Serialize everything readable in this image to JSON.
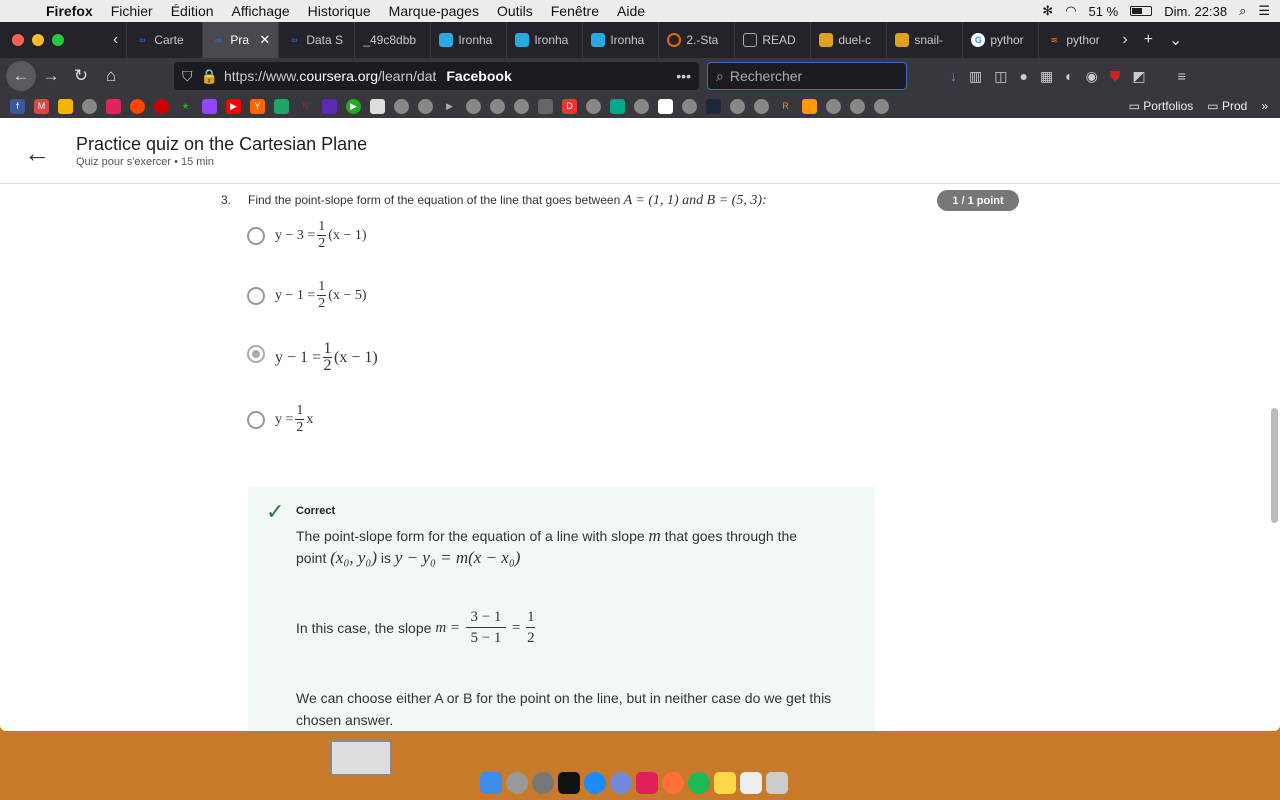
{
  "menubar": {
    "app": "Firefox",
    "items": [
      "Fichier",
      "Édition",
      "Affichage",
      "Historique",
      "Marque-pages",
      "Outils",
      "Fenêtre",
      "Aide"
    ],
    "battery": "51 %",
    "clock": "Dim. 22:38"
  },
  "tabs": [
    {
      "label": "Carte",
      "color": "#3d6fe0"
    },
    {
      "label": "Pra",
      "color": "#3d6fe0",
      "active": true
    },
    {
      "label": "Data S",
      "color": "#3d6fe0"
    },
    {
      "label": "_49c8dbb",
      "color": "#555"
    },
    {
      "label": "Ironha",
      "color": "#2aa9e0"
    },
    {
      "label": "Ironha",
      "color": "#2aa9e0"
    },
    {
      "label": "Ironha",
      "color": "#2aa9e0"
    },
    {
      "label": "2.-Sta",
      "color": "#e06a10"
    },
    {
      "label": "READ",
      "color": "#777"
    },
    {
      "label": "duel-c",
      "color": "#e0a020"
    },
    {
      "label": "snail-",
      "color": "#e0a020"
    },
    {
      "label": "pythor",
      "color": "#ffffff"
    },
    {
      "label": "pythor",
      "color": "#f48024"
    }
  ],
  "nav": {
    "url_prefix": "https://www.",
    "url_host": "coursera.org",
    "url_path": "/learn/dat",
    "page_label": "Facebook",
    "search_placeholder": "Rechercher"
  },
  "bookmarks": {
    "folders": [
      "Portfolios",
      "Prod"
    ]
  },
  "quiz": {
    "title": "Practice quiz on the Cartesian Plane",
    "subtitle": "Quiz pour s'exercer • 15 min",
    "question_number": "3.",
    "question_text": "Find the point-slope form of the equation of the line that goes between",
    "question_math": "A = (1, 1) and B = (5, 3):",
    "score": "1 / 1 point",
    "options": [
      {
        "lhs": "y − 3 =",
        "num": "1",
        "den": "2",
        "rhs": "(x − 1)"
      },
      {
        "lhs": "y − 1 =",
        "num": "1",
        "den": "2",
        "rhs": "(x − 5)"
      },
      {
        "lhs": "y − 1 =",
        "num": "1",
        "den": "2",
        "rhs": "(x − 1)",
        "selected": true
      },
      {
        "lhs": "y =",
        "num": "1",
        "den": "2",
        "rhs": "x"
      }
    ],
    "feedback": {
      "status": "Correct",
      "line1": "The point-slope form for the equation of a line with slope",
      "line1_var": "m",
      "line1_end": "that goes through the",
      "line2_start": "point",
      "line2_point": "(x₀, y₀)",
      "line2_mid": "is",
      "line2_formula": "y − y₀ = m(x − x₀)",
      "slope_text": "In this case, the slope",
      "slope_var": "m =",
      "slope_num": "3 − 1",
      "slope_den": "5 − 1",
      "slope_eq": "=",
      "slope_res_num": "1",
      "slope_res_den": "2",
      "final_text": "We can choose either A or B for the point on the line, but in neither case do we get this chosen answer."
    }
  }
}
